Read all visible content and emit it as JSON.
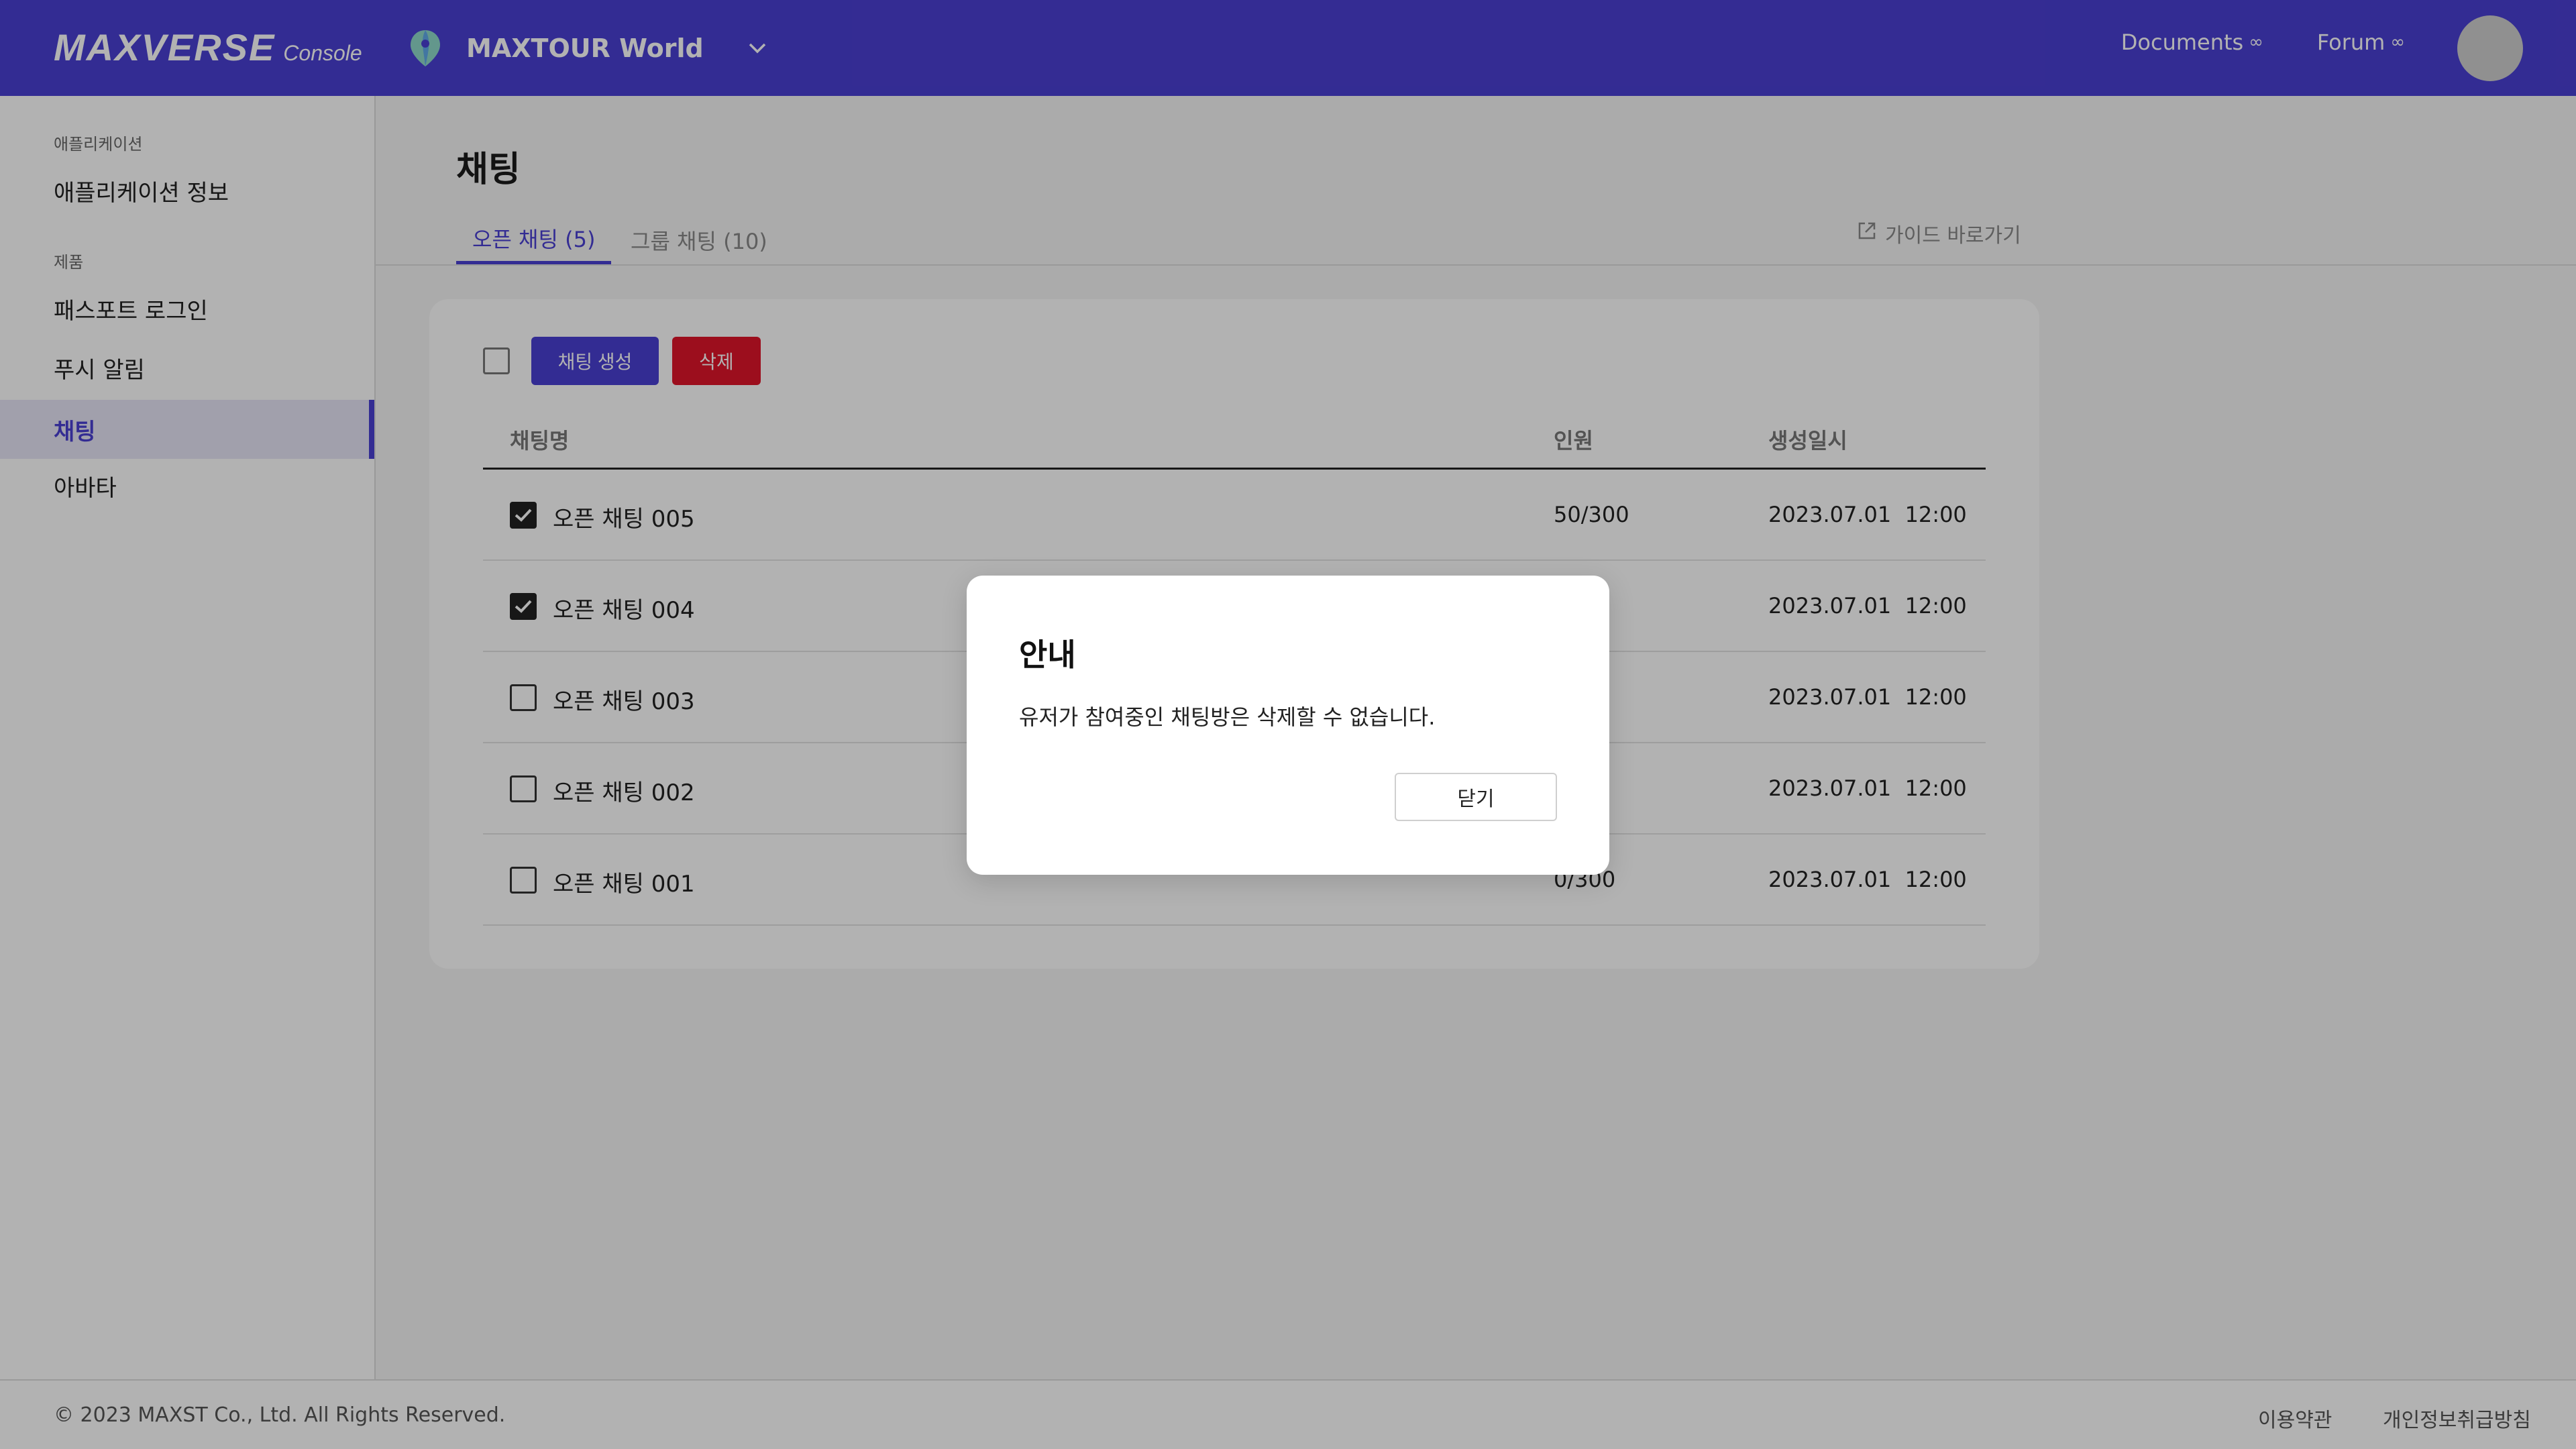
{
  "header": {
    "logo_main": "MAXVERSE",
    "logo_sub": "Console",
    "project_icon": "map-pin-icon",
    "project_name": "MAXTOUR World",
    "links": [
      {
        "label": "Documents",
        "icon": "external-link-icon"
      },
      {
        "label": "Forum",
        "icon": "external-link-icon"
      }
    ],
    "accent": "#4a3fd3"
  },
  "sidebar": {
    "sections": [
      {
        "label": "애플리케이션",
        "items": [
          {
            "label": "애플리케이션 정보"
          }
        ]
      },
      {
        "label": "제품",
        "items": [
          {
            "label": "패스포트 로그인"
          },
          {
            "label": "푸시 알림"
          },
          {
            "label": "채팅",
            "active": true
          },
          {
            "label": "아바타"
          }
        ]
      }
    ]
  },
  "main": {
    "title": "채팅",
    "tabs": [
      {
        "label": "오픈 채팅 (5)",
        "active": true
      },
      {
        "label": "그룹 채팅 (10)",
        "active": false
      }
    ],
    "guide_link": "가이드 바로가기",
    "toolbar": {
      "create_label": "채팅 생성",
      "delete_label": "삭제",
      "delete_color": "#e0152a"
    },
    "table": {
      "headers": [
        "채팅명",
        "인원",
        "생성일시"
      ],
      "rows": [
        {
          "name": "오픈 채팅 005",
          "members": "50/300",
          "date": "2023.07.01  12:00",
          "checked": true
        },
        {
          "name": "오픈 채팅 004",
          "members": "",
          "date": "2023.07.01  12:00",
          "checked": true
        },
        {
          "name": "오픈 채팅 003",
          "members": "",
          "date": "2023.07.01  12:00",
          "checked": false
        },
        {
          "name": "오픈 채팅 002",
          "members": "",
          "date": "2023.07.01  12:00",
          "checked": false
        },
        {
          "name": "오픈 채팅 001",
          "members": "0/300",
          "date": "2023.07.01  12:00",
          "checked": false
        }
      ]
    }
  },
  "modal": {
    "title": "안내",
    "message": "유저가 참여중인 채팅방은 삭제할 수 없습니다.",
    "close_label": "닫기"
  },
  "footer": {
    "copyright": "© 2023 MAXST Co., Ltd. All Rights Reserved.",
    "terms": "이용약관",
    "privacy": "개인정보취급방침"
  }
}
